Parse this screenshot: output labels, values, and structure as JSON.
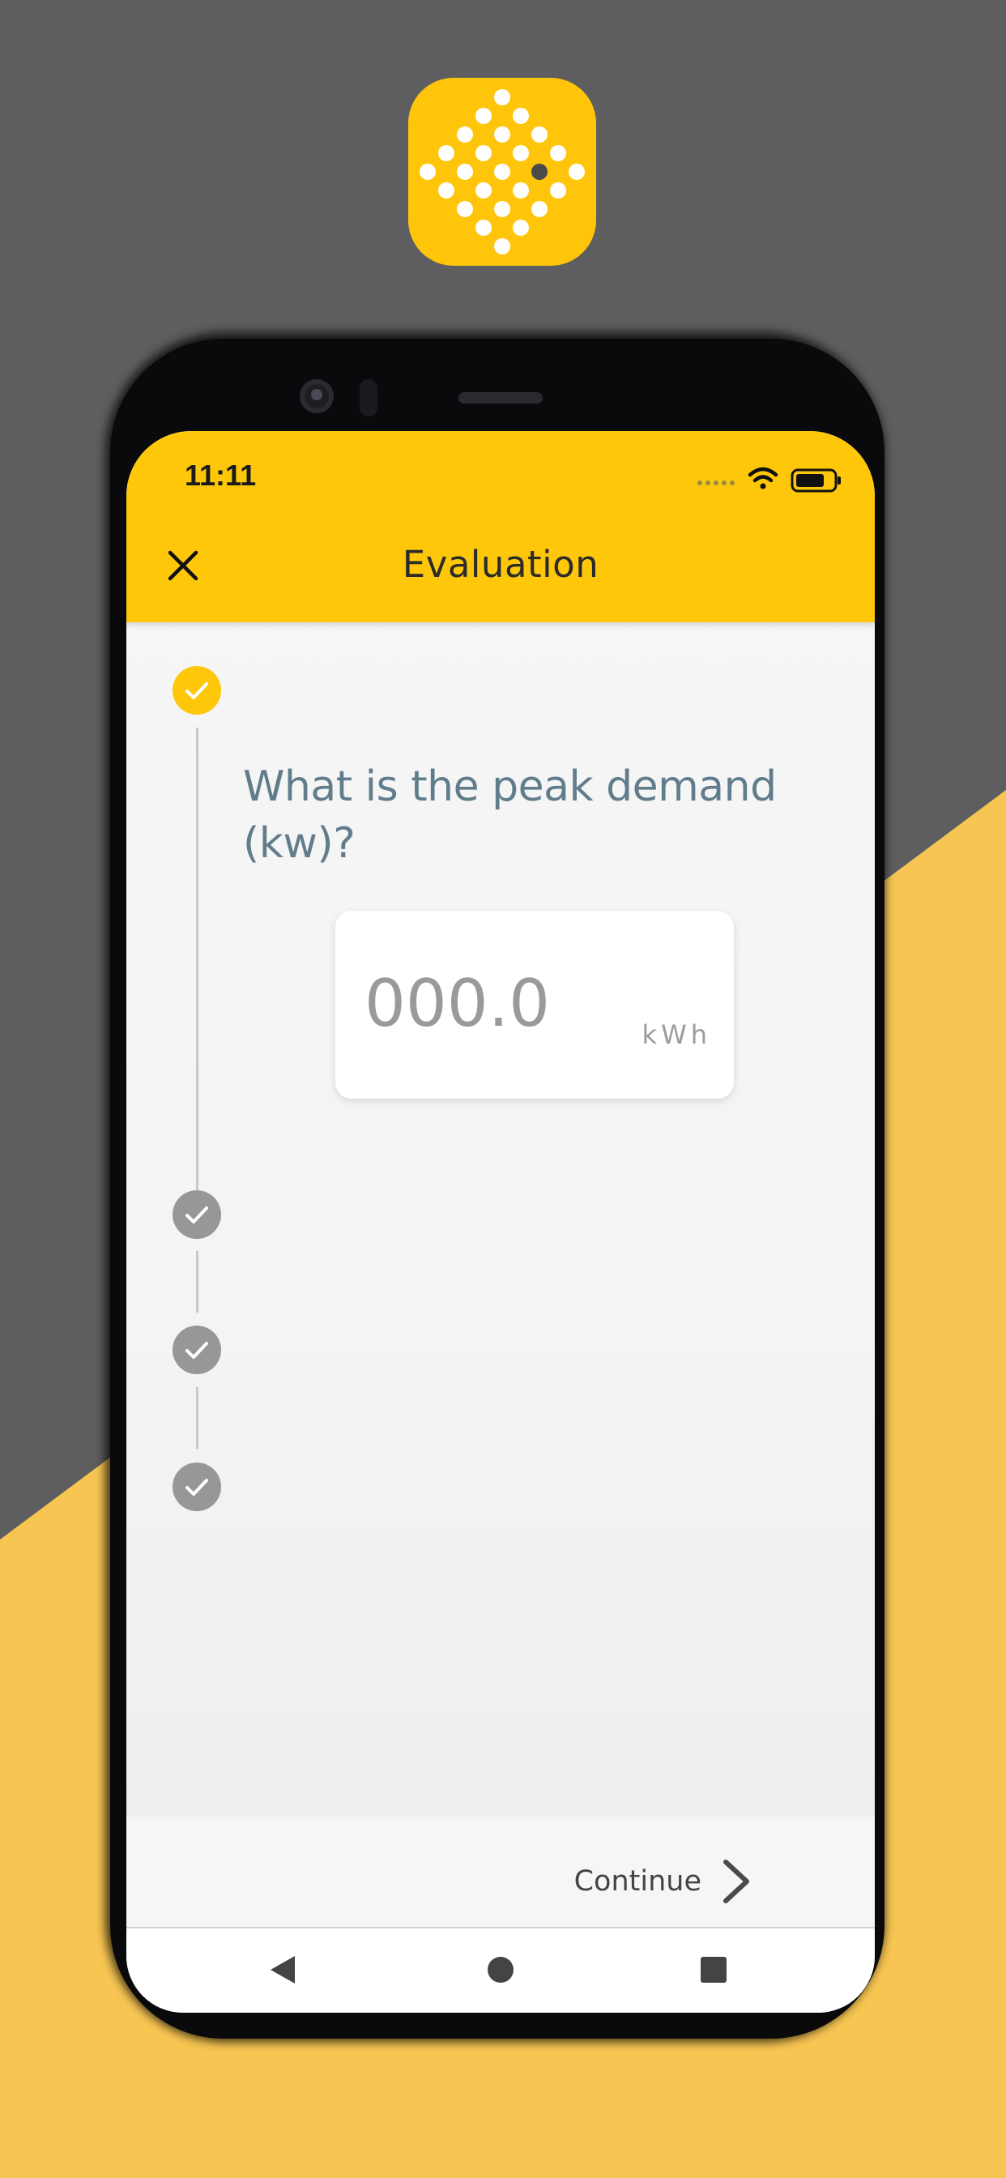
{
  "colors": {
    "brand_yellow": "#fec70a",
    "background_dark": "#5e5e60",
    "background_yellow": "#f7c552",
    "question_text": "#617d8c",
    "step_inactive": "#979797"
  },
  "app_icon": {
    "icon": "dot-diamond-logo-icon"
  },
  "status_bar": {
    "time": "11:11",
    "icons": [
      "signal-dots-icon",
      "wifi-icon",
      "battery-icon"
    ]
  },
  "app_bar": {
    "title": "Evaluation",
    "close_icon": "close-icon"
  },
  "stepper": {
    "steps": [
      {
        "state": "active",
        "icon": "check-icon"
      },
      {
        "state": "inactive",
        "icon": "check-icon"
      },
      {
        "state": "inactive",
        "icon": "check-icon"
      },
      {
        "state": "inactive",
        "icon": "check-icon"
      }
    ]
  },
  "question": {
    "text": "What is the peak demand (kw)?",
    "input_value": "",
    "input_placeholder": "000.0",
    "unit": "kWh"
  },
  "footer": {
    "continue_label": "Continue",
    "continue_icon": "chevron-right-icon"
  },
  "nav_bar": {
    "buttons": [
      "back-icon",
      "home-icon",
      "recents-icon"
    ]
  }
}
